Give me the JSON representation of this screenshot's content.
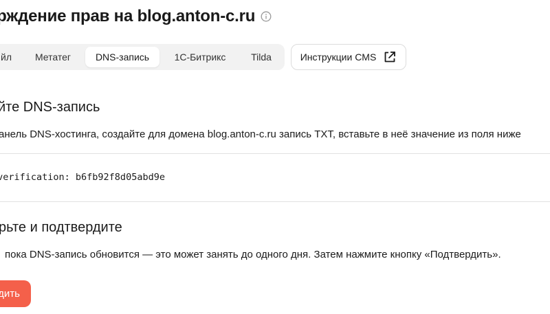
{
  "header": {
    "title": "ерждение прав на blog.anton-c.ru"
  },
  "tabs": [
    {
      "label": "йл",
      "active": false
    },
    {
      "label": "Метатег",
      "active": false
    },
    {
      "label": "DNS-запись",
      "active": true
    },
    {
      "label": "1С-Битрикс",
      "active": false
    },
    {
      "label": "Tilda",
      "active": false
    }
  ],
  "cms_button": {
    "label": "Инструкции CMS",
    "icon": "external-link-icon"
  },
  "step1": {
    "title": "йте DNS-запись",
    "text": "анель DNS-хостинга, создайте для домена blog.anton-c.ru запись TXT, вставьте в неё значение из поля ниже"
  },
  "verification": {
    "value": "-verification: b6fb92f8d05abd9e"
  },
  "step2": {
    "title": "рьте и подтвердите",
    "text": "пока DNS-запись обновится — это может занять до одного дня. Затем нажмите кнопку «Подтвердить»."
  },
  "confirm_button": {
    "label": "дить",
    "color": "#f4604a"
  },
  "colors": {
    "accent": "#f4604a",
    "tab_bg": "#f2f2f2",
    "divider": "#e2e2e2"
  }
}
